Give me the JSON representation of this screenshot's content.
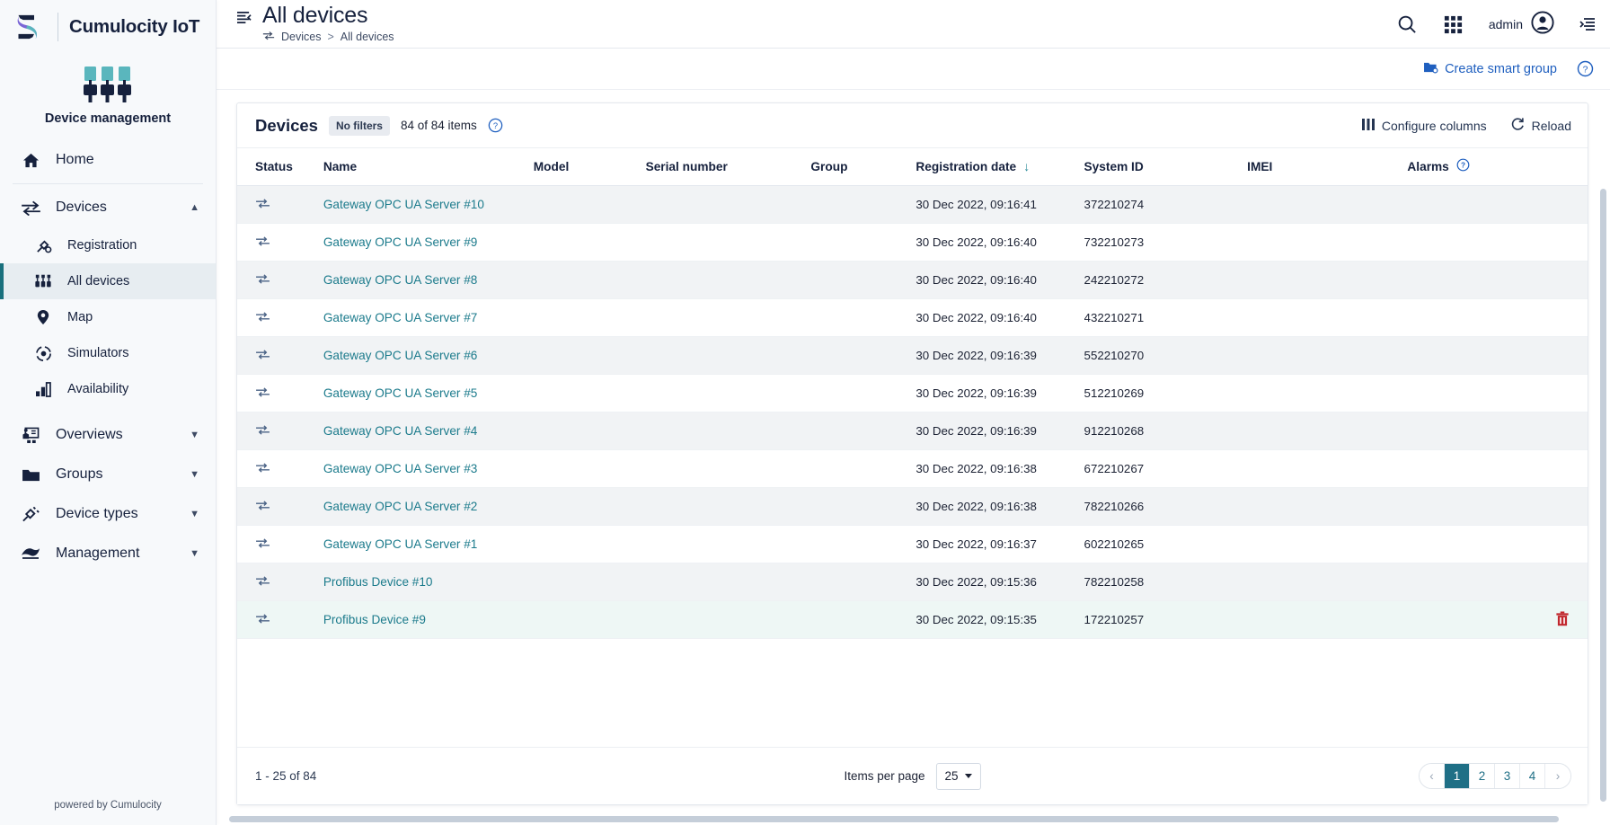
{
  "brand": {
    "name": "Cumulocity IoT",
    "app_label": "Device management",
    "powered_by": "powered by Cumulocity",
    "logo_icon": "cumulocity-s-logo",
    "app_icon": "device-management-icon"
  },
  "sidebar": {
    "items": [
      {
        "label": "Home",
        "icon": "home-icon",
        "level": "top",
        "active": false,
        "chevron": ""
      },
      {
        "label": "Devices",
        "icon": "devices-transfer-icon",
        "level": "top",
        "active": false,
        "chevron": "up"
      },
      {
        "label": "Registration",
        "icon": "registration-plug-icon",
        "level": "sub",
        "active": false,
        "chevron": ""
      },
      {
        "label": "All devices",
        "icon": "all-devices-icon",
        "level": "sub",
        "active": true,
        "chevron": ""
      },
      {
        "label": "Map",
        "icon": "map-pin-icon",
        "level": "sub",
        "active": false,
        "chevron": ""
      },
      {
        "label": "Simulators",
        "icon": "simulators-icon",
        "level": "sub",
        "active": false,
        "chevron": ""
      },
      {
        "label": "Availability",
        "icon": "availability-bars-icon",
        "level": "sub",
        "active": false,
        "chevron": ""
      },
      {
        "label": "Overviews",
        "icon": "overviews-icon",
        "level": "top",
        "active": false,
        "chevron": "down"
      },
      {
        "label": "Groups",
        "icon": "folder-icon",
        "level": "top",
        "active": false,
        "chevron": "down"
      },
      {
        "label": "Device types",
        "icon": "device-types-plug-icon",
        "level": "top",
        "active": false,
        "chevron": "down"
      },
      {
        "label": "Management",
        "icon": "management-icon",
        "level": "top",
        "active": false,
        "chevron": "down"
      }
    ]
  },
  "header": {
    "title": "All devices",
    "collapse_icon": "collapse-menu-icon",
    "breadcrumb": {
      "icon": "devices-transfer-icon",
      "parent": "Devices",
      "separator": ">",
      "current": "All devices"
    },
    "search_icon": "search-icon",
    "apps_icon": "app-switcher-grid-icon",
    "user_name": "admin",
    "avatar_icon": "user-avatar-icon",
    "right_drawer_icon": "right-drawer-toggle-icon"
  },
  "actionbar": {
    "create_smart_group": "Create smart group",
    "create_smart_group_icon": "smart-group-folder-icon",
    "help_icon": "help-circle-icon"
  },
  "card": {
    "title": "Devices",
    "filters_badge": "No filters",
    "items_count": "84 of 84 items",
    "help_icon": "help-circle-icon",
    "configure_columns": "Configure columns",
    "configure_columns_icon": "columns-icon",
    "reload": "Reload",
    "reload_icon": "reload-icon"
  },
  "table": {
    "columns": [
      {
        "label": "Status",
        "key": "status"
      },
      {
        "label": "Name",
        "key": "name"
      },
      {
        "label": "Model",
        "key": "model"
      },
      {
        "label": "Serial number",
        "key": "serial"
      },
      {
        "label": "Group",
        "key": "group"
      },
      {
        "label": "Registration date",
        "key": "date",
        "sorted": "desc",
        "sort_icon": "arrow-down-icon"
      },
      {
        "label": "System ID",
        "key": "system_id"
      },
      {
        "label": "IMEI",
        "key": "imei"
      },
      {
        "label": "Alarms",
        "key": "alarms",
        "help_icon": "help-circle-icon"
      }
    ],
    "rows": [
      {
        "status_icon": "device-transfer-icon",
        "name": "Gateway OPC UA Server #10",
        "model": "",
        "serial": "",
        "group": "",
        "date": "30 Dec 2022, 09:16:41",
        "system_id": "372210274",
        "imei": "",
        "alarms": "",
        "hovered": false
      },
      {
        "status_icon": "device-transfer-icon",
        "name": "Gateway OPC UA Server #9",
        "model": "",
        "serial": "",
        "group": "",
        "date": "30 Dec 2022, 09:16:40",
        "system_id": "732210273",
        "imei": "",
        "alarms": "",
        "hovered": false
      },
      {
        "status_icon": "device-transfer-icon",
        "name": "Gateway OPC UA Server #8",
        "model": "",
        "serial": "",
        "group": "",
        "date": "30 Dec 2022, 09:16:40",
        "system_id": "242210272",
        "imei": "",
        "alarms": "",
        "hovered": false
      },
      {
        "status_icon": "device-transfer-icon",
        "name": "Gateway OPC UA Server #7",
        "model": "",
        "serial": "",
        "group": "",
        "date": "30 Dec 2022, 09:16:40",
        "system_id": "432210271",
        "imei": "",
        "alarms": "",
        "hovered": false
      },
      {
        "status_icon": "device-transfer-icon",
        "name": "Gateway OPC UA Server #6",
        "model": "",
        "serial": "",
        "group": "",
        "date": "30 Dec 2022, 09:16:39",
        "system_id": "552210270",
        "imei": "",
        "alarms": "",
        "hovered": false
      },
      {
        "status_icon": "device-transfer-icon",
        "name": "Gateway OPC UA Server #5",
        "model": "",
        "serial": "",
        "group": "",
        "date": "30 Dec 2022, 09:16:39",
        "system_id": "512210269",
        "imei": "",
        "alarms": "",
        "hovered": false
      },
      {
        "status_icon": "device-transfer-icon",
        "name": "Gateway OPC UA Server #4",
        "model": "",
        "serial": "",
        "group": "",
        "date": "30 Dec 2022, 09:16:39",
        "system_id": "912210268",
        "imei": "",
        "alarms": "",
        "hovered": false
      },
      {
        "status_icon": "device-transfer-icon",
        "name": "Gateway OPC UA Server #3",
        "model": "",
        "serial": "",
        "group": "",
        "date": "30 Dec 2022, 09:16:38",
        "system_id": "672210267",
        "imei": "",
        "alarms": "",
        "hovered": false
      },
      {
        "status_icon": "device-transfer-icon",
        "name": "Gateway OPC UA Server #2",
        "model": "",
        "serial": "",
        "group": "",
        "date": "30 Dec 2022, 09:16:38",
        "system_id": "782210266",
        "imei": "",
        "alarms": "",
        "hovered": false
      },
      {
        "status_icon": "device-transfer-icon",
        "name": "Gateway OPC UA Server #1",
        "model": "",
        "serial": "",
        "group": "",
        "date": "30 Dec 2022, 09:16:37",
        "system_id": "602210265",
        "imei": "",
        "alarms": "",
        "hovered": false
      },
      {
        "status_icon": "device-transfer-icon",
        "name": "Profibus Device #10",
        "model": "",
        "serial": "",
        "group": "",
        "date": "30 Dec 2022, 09:15:36",
        "system_id": "782210258",
        "imei": "",
        "alarms": "",
        "hovered": false
      },
      {
        "status_icon": "device-transfer-icon",
        "name": "Profibus Device #9",
        "model": "",
        "serial": "",
        "group": "",
        "date": "30 Dec 2022, 09:15:35",
        "system_id": "172210257",
        "imei": "",
        "alarms": "",
        "hovered": true,
        "delete_icon": "trash-icon"
      }
    ]
  },
  "pagination": {
    "range": "1 - 25 of 84",
    "items_per_page_label": "Items per page",
    "items_per_page_value": "25",
    "prev_icon": "chevron-left-icon",
    "next_icon": "chevron-right-icon",
    "pages": [
      "1",
      "2",
      "3",
      "4"
    ],
    "active_page": "1"
  },
  "colors": {
    "accent_teal": "#1f6f86",
    "link_blue": "#1f5fbf",
    "device_link": "#1c7b8c",
    "danger_red": "#c1272d",
    "navy": "#16213d",
    "sidebar_bg": "#f7f9fb"
  }
}
